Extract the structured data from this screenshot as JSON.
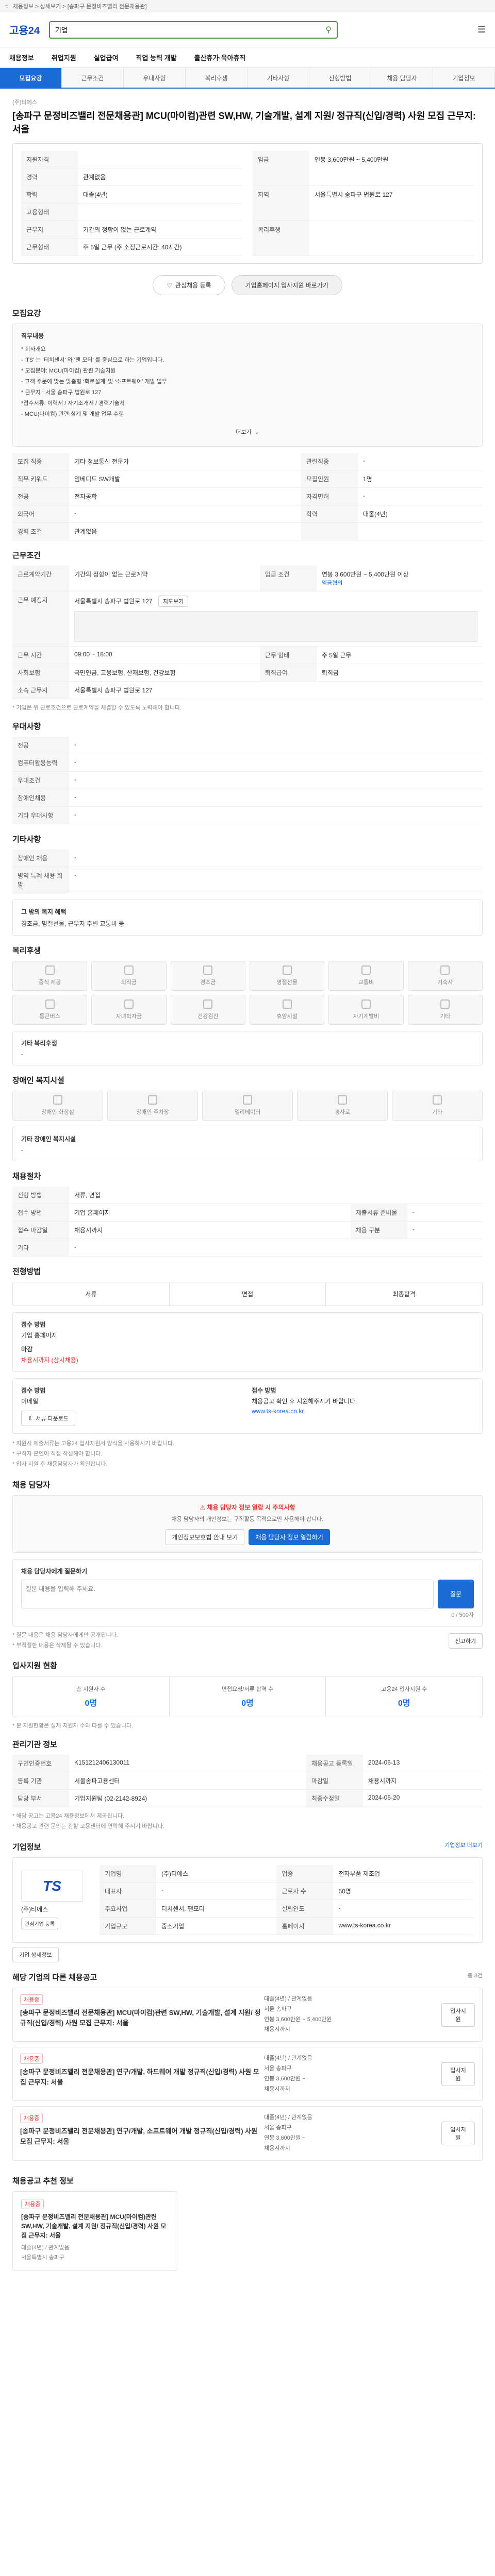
{
  "topbar": {
    "breadcrumb": "채용정보 > 상세보기 > [송파구 문정비즈밸리 전문채용관]"
  },
  "header": {
    "logo": "고용24",
    "search_value": "기업",
    "search_placeholder": "검색어를 입력하세요"
  },
  "nav": {
    "items": [
      "채용정보",
      "취업지원",
      "실업급여",
      "직업 능력 개발",
      "출산휴가·육아휴직"
    ]
  },
  "tabs": {
    "items": [
      "모집요강",
      "근무조건",
      "우대사항",
      "복리후생",
      "기타사항",
      "전형방법",
      "채용 담당자",
      "기업정보"
    ]
  },
  "job": {
    "company_line": "(주)티에스",
    "title": "[송파구 문정비즈밸리 전문채용관] MCU(마이컴)관련 SW,HW, 기술개발, 설계 지원/ 정규직(신입/경력) 사원 모집 근무지: 서울",
    "summary": {
      "rows": [
        {
          "k": "지원자격",
          "v": ""
        },
        {
          "k": "경력",
          "v": "관계없음"
        },
        {
          "k": "학력",
          "v": "대졸(4년)"
        },
        {
          "k": "고용형태",
          "v": ""
        },
        {
          "k": "근무지",
          "v": "기간의 정함이 없는 근로계약"
        },
        {
          "k": "근무형태",
          "v": "주 5일 근무 (주 소정근로시간: 40시간)"
        }
      ],
      "right": [
        {
          "k": "임금",
          "v": "연봉 3,600만원 ~ 5,400만원"
        },
        {
          "k": "지역",
          "v": "서울특별시 송파구 법원로 127"
        },
        {
          "k": "복리후생",
          "v": ""
        }
      ]
    },
    "apply_buttons": {
      "interest": "관심채용 등록",
      "apply": "기업홈페이지 입사지원 바로가기"
    }
  },
  "recruit": {
    "title": "모집요강",
    "duty_label": "직무내용",
    "duty_lines": [
      "* 회사개요",
      "- ‘TS’ 는 ‘터치센서’ 와 ‘팬 모터’ 를 중심으로 하는 기업입니다.",
      "* 모집분야: MCU(마이컴) 관련 기술지원",
      "- 고객 주문에 맞는 맞춤형 ‘회로설계’ 및 ‘소프트웨어’ 개발 업무",
      "* 근무지 : 서울 송파구 법원로 127",
      "*접수서류: 이력서 / 자기소개서 / 경력기술서",
      "- MCU(마이컴) 관련 설계 및 개발 업무 수행"
    ],
    "more": "더보기",
    "table": [
      {
        "k": "모집 직종",
        "v": "기타 정보통신 전문가",
        "k2": "관련직종",
        "v2": "-"
      },
      {
        "k": "직무 키워드",
        "v": "임베디드 SW개발",
        "k2": "모집인원",
        "v2": "1명"
      },
      {
        "k": "전공",
        "v": "전자공학",
        "k2": "자격면허",
        "v2": "-"
      },
      {
        "k": "외국어",
        "v": "-",
        "k2": "학력",
        "v2": "대졸(4년)"
      },
      {
        "k": "경력 조건",
        "v": "관계없음",
        "k2": "",
        "v2": ""
      }
    ]
  },
  "work": {
    "title": "근무조건",
    "contract": "기간의 정함이 없는 근로계약",
    "wage": "연봉 3,600만원 ~ 5,400만원 이상",
    "wage_note": "임금협의",
    "address": "서울특별시 송파구 법원로 127",
    "map_button": "지도보기",
    "hours_label": "근무 시간",
    "hours": "09:00 ~ 18:00",
    "days": "주 5일 근무",
    "break": "60분",
    "insurance": "국민연금, 고용보험, 산재보험, 건강보험",
    "severance": "퇴직금",
    "table": [
      {
        "k": "근로계약기간",
        "v": "기간의 정함이 없는 근로계약",
        "k2": "임금 조건",
        "v2": "연봉 3,600만원 ~ 5,400만원 이상"
      },
      {
        "k": "근무 예정지",
        "v": "서울특별시 송파구 법원로 127",
        "k2": "",
        "v2": ""
      },
      {
        "k": "근무 시간",
        "v": "09:00 ~ 18:00",
        "k2": "근무 형태",
        "v2": "주 5일 근무"
      },
      {
        "k": "사회보험",
        "v": "국민연금, 고용보험, 산재보험, 건강보험",
        "k2": "퇴직급여",
        "v2": "퇴직금"
      },
      {
        "k": "소속 근무지",
        "v": "서울특별시 송파구 법원로 127",
        "k2": "",
        "v2": ""
      }
    ],
    "note": "* 기업은 위 근로조건으로 근로계약을 체결할 수 있도록 노력해야 합니다."
  },
  "prefer": {
    "title": "우대사항",
    "rows": [
      {
        "k": "전공",
        "v": "-"
      },
      {
        "k": "컴퓨터활용능력",
        "v": "-"
      },
      {
        "k": "우대조건",
        "v": "-"
      },
      {
        "k": "장애인채용",
        "v": "-"
      },
      {
        "k": "기타 우대사항",
        "v": "-"
      }
    ]
  },
  "etc": {
    "title": "기타사항",
    "rows": [
      {
        "k": "장애인 채용",
        "v": "-"
      },
      {
        "k": "병역 특례 채용 희망",
        "v": "-"
      }
    ],
    "extra_label": "그 밖의 복지 혜택",
    "extra_text": "경조금, 명절선물, 근무지 주변 교통비 등"
  },
  "welfare": {
    "title": "복리후생",
    "items": [
      "중식 제공",
      "퇴직금",
      "경조금",
      "명절선물",
      "교통비",
      "기숙사",
      "통근버스",
      "자녀학자금",
      "건강검진",
      "휴양시설",
      "자기계발비",
      "기타"
    ],
    "etc_label": "기타 복리후생",
    "etc_value": "-"
  },
  "disability": {
    "title": "장애인 복지시설",
    "items": [
      "장애인 화장실",
      "장애인 주차장",
      "엘리베이터",
      "경사로",
      "기타"
    ],
    "etc_label": "기타 장애인 복지시설",
    "etc_value": "-"
  },
  "selection": {
    "title": "채용절차",
    "rows": [
      {
        "k": "전형 방법",
        "v": "서류, 면접"
      },
      {
        "k": "접수 방법",
        "v": "기업 홈페이지",
        "k2": "제출서류 준비물",
        "v2": "-"
      },
      {
        "k": "접수 마감일",
        "v": "채용시까지",
        "k2": "채용 구분",
        "v2": "-"
      },
      {
        "k": "기타",
        "v": "-",
        "k2": "",
        "v2": ""
      }
    ]
  },
  "process": {
    "title": "전형방법",
    "steps": [
      "서류",
      "면접",
      "최종합격"
    ],
    "method_label": "접수 방법",
    "method_value": "기업 홈페이지",
    "deadline_label": "마감",
    "deadline_value": "채용시까지 (상시채용)",
    "submit_label": "접수 방법",
    "submit_value": "이메일",
    "submit_note": "채용공고 확인 후 지원해주시기 바랍니다.",
    "homepage": "www.ts-korea.co.kr",
    "contact_label": "접수 방법",
    "doc_button": "서류 다운로드",
    "notes": [
      "* 지원시 제출서류는 고용24 입사지원서 양식을 사용하시기 바랍니다.",
      "* 구직자 본인이 직접 작성해야 합니다.",
      "* 입사 지원 후 채용담당자가 확인합니다."
    ]
  },
  "contact": {
    "title": "채용 담당자",
    "notice_title": "채용 담당자 정보 열람 시 주의사항",
    "notice_text": "채용 담당자의 개인정보는 구직활동 목적으로만 사용해야 합니다.",
    "btn_view": "채용 담당자 정보 열람하기",
    "btn_guide": "개인정보보호법 안내 보기",
    "question_label": "채용 담당자에게 질문하기",
    "question_placeholder": "질문 내용을 입력해 주세요.",
    "question_btn": "질문",
    "counter": "0 / 500자",
    "notes": [
      "* 질문 내용은 채용 담당자에게만 공개됩니다.",
      "* 부적절한 내용은 삭제될 수 있습니다."
    ],
    "report_btn": "신고하기"
  },
  "support": {
    "title": "입사지원 현황",
    "items": [
      {
        "label": "총 지원자 수",
        "value": "0명"
      },
      {
        "label": "면접요청/서류 합격 수",
        "value": "0명"
      },
      {
        "label": "고용24 입사지원 수",
        "value": "0명"
      }
    ],
    "note": "* 본 지원현황은 실제 지원자 수와 다를 수 있습니다."
  },
  "manage": {
    "title": "관리기관 정보",
    "rows": [
      {
        "k": "구인인증번호",
        "v": "K151212406130011",
        "k2": "채용공고 등록일",
        "v2": "2024-06-13"
      },
      {
        "k": "등록 기관",
        "v": "서울송파고용센터",
        "k2": "마감일",
        "v2": "채용시까지"
      },
      {
        "k": "담당 부서",
        "v": "기업지원팀 (02-2142-8924)",
        "k2": "최종수정일",
        "v2": "2024-06-20"
      }
    ],
    "notes": [
      "* 해당 공고는 고용24 채용정보에서 제공됩니다.",
      "* 채용공고 관련 문의는 관할 고용센터에 연락해 주시기 바랍니다."
    ]
  },
  "company": {
    "title": "기업정보",
    "more": "기업정보 더보기",
    "logo_text": "TS",
    "name": "(주)티에스",
    "rows": [
      {
        "k": "기업명",
        "v": "(주)티에스",
        "k2": "업종",
        "v2": "전자부품 제조업"
      },
      {
        "k": "대표자",
        "v": "-",
        "k2": "근로자 수",
        "v2": "50명"
      },
      {
        "k": "주요사업",
        "v": "터치센서, 팬모터",
        "k2": "설립연도",
        "v2": "-"
      },
      {
        "k": "기업규모",
        "v": "중소기업",
        "k2": "홈페이지",
        "v2": "www.ts-korea.co.kr"
      }
    ],
    "buttons": [
      "관심기업 등록",
      "기업 상세정보"
    ]
  },
  "same_company": {
    "title": "해당 기업의 다른 채용공고",
    "count_note": "총 3건",
    "items": [
      {
        "badge": "채용중",
        "title": "[송파구 문정비즈밸리 전문채용관] MCU(마이컴)관련 SW,HW, 기술개발, 설계 지원/ 정규직(신입/경력) 사원 모집 근무지: 서울",
        "details": [
          "대졸(4년) / 관계없음",
          "서울 송파구",
          "연봉 3,600만원 ~ 5,400만원",
          "채용시까지"
        ],
        "action": "입사지원"
      },
      {
        "badge": "채용중",
        "title": "[송파구 문정비즈밸리 전문채용관] 연구/개발, 하드웨어 개발 정규직(신입/경력) 사원 모집 근무지: 서울",
        "details": [
          "대졸(4년) / 관계없음",
          "서울 송파구",
          "연봉 3,600만원 ~",
          "채용시까지"
        ],
        "action": "입사지원"
      },
      {
        "badge": "채용중",
        "title": "[송파구 문정비즈밸리 전문채용관] 연구/개발, 소프트웨어 개발 정규직(신입/경력) 사원 모집 근무지: 서울",
        "details": [
          "대졸(4년) / 관계없음",
          "서울 송파구",
          "연봉 3,600만원 ~",
          "채용시까지"
        ],
        "action": "입사지원"
      }
    ]
  },
  "recommend": {
    "title": "채용공고 추천 정보",
    "item": {
      "badge": "채용중",
      "title": "[송파구 문정비즈밸리 전문채용관] MCU(마이컴)관련 SW,HW, 기술개발, 설계 지원/ 정규직(신입/경력) 사원 모집 근무지: 서울",
      "details": [
        "대졸(4년) / 관계없음",
        "서울특별시 송파구"
      ]
    }
  }
}
